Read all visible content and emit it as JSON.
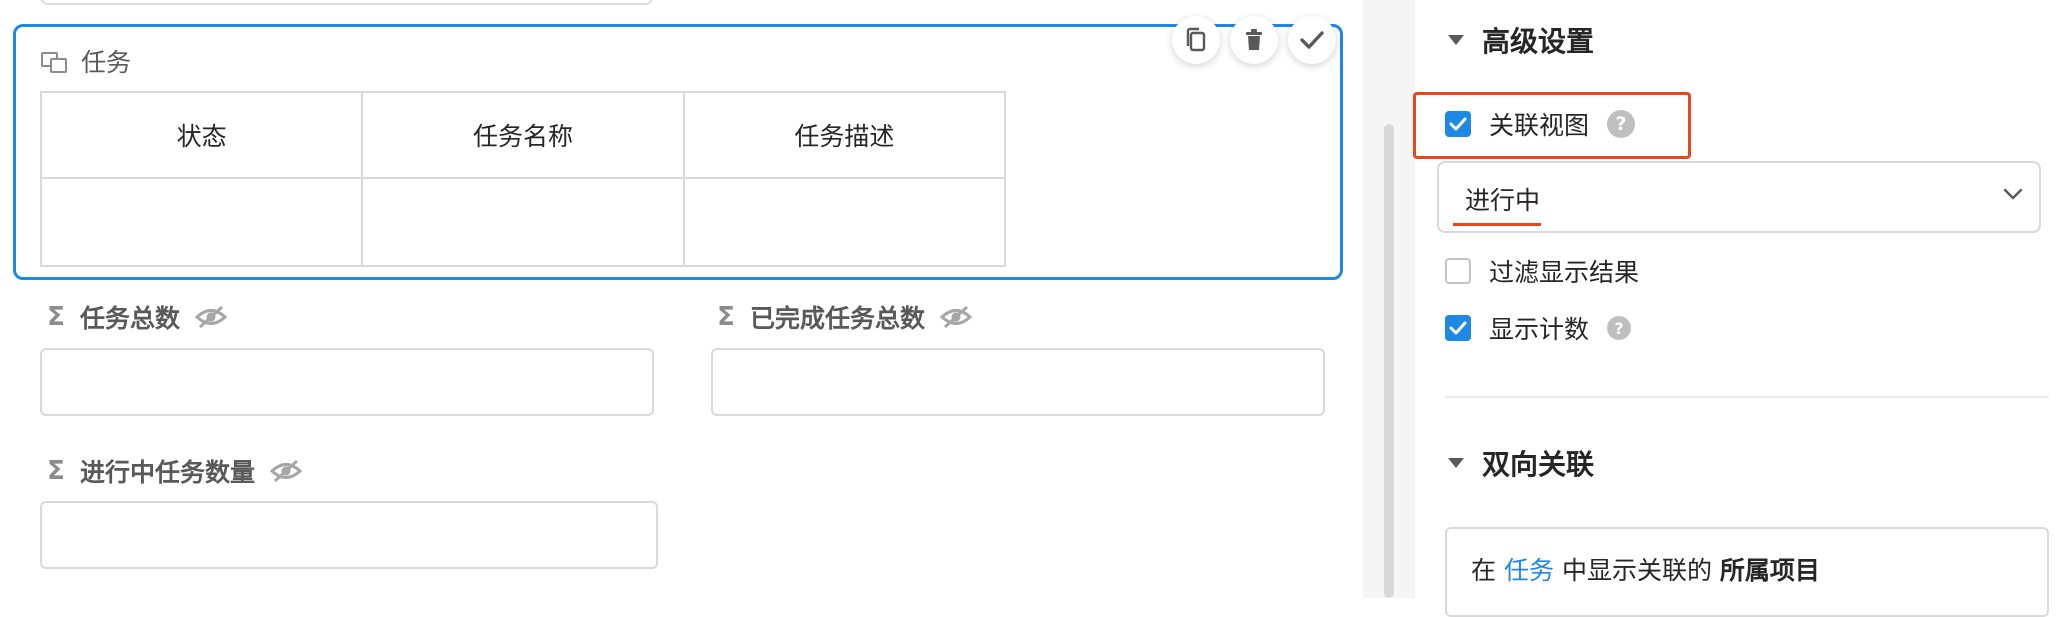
{
  "form": {
    "task_field": {
      "label": "任务",
      "columns": [
        "状态",
        "任务名称",
        "任务描述"
      ]
    },
    "fields": [
      {
        "label": "任务总数"
      },
      {
        "label": "已完成任务总数"
      },
      {
        "label": "进行中任务数量"
      }
    ],
    "sigma": "Σ"
  },
  "panel": {
    "advanced": {
      "title": "高级设置",
      "related_view": {
        "label": "关联视图",
        "checked": true
      },
      "view_select": {
        "value": "进行中"
      },
      "filter_results": {
        "label": "过滤显示结果",
        "checked": false
      },
      "show_count": {
        "label": "显示计数",
        "checked": true
      },
      "help_glyph": "?"
    },
    "bidirectional": {
      "title": "双向关联",
      "sentence": {
        "prefix": "在",
        "link": "任务",
        "middle": "中显示关联的",
        "target": "所属项目"
      }
    }
  },
  "colors": {
    "accent": "#1e88e5",
    "highlight": "#e8471c"
  },
  "icons": [
    "link-icon",
    "copy-icon",
    "trash-icon",
    "check-icon",
    "sigma-icon",
    "eye-off-icon",
    "triangle-down-icon",
    "chevron-down-icon",
    "help-icon"
  ]
}
